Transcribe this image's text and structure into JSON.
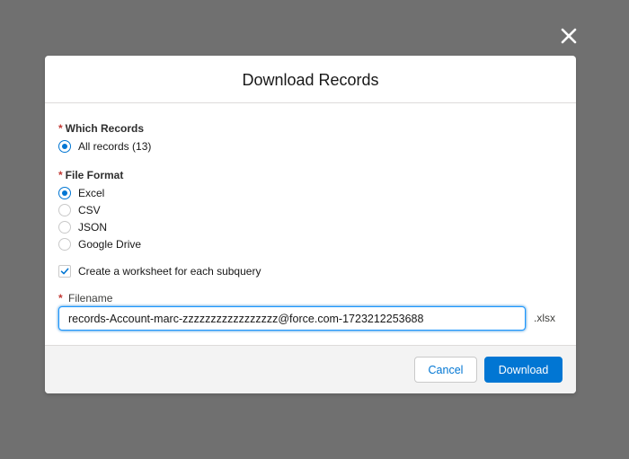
{
  "modal": {
    "title": "Download Records",
    "close_icon": "close-icon"
  },
  "which_records": {
    "label": "Which Records",
    "required_mark": "*",
    "options": [
      {
        "label": "All records (13)",
        "selected": true
      }
    ]
  },
  "file_format": {
    "label": "File Format",
    "required_mark": "*",
    "options": [
      {
        "label": "Excel",
        "selected": true
      },
      {
        "label": "CSV",
        "selected": false
      },
      {
        "label": "JSON",
        "selected": false
      },
      {
        "label": "Google Drive",
        "selected": false
      }
    ]
  },
  "worksheet_option": {
    "label": "Create a worksheet for each subquery",
    "checked": true
  },
  "filename": {
    "label": "Filename",
    "required_mark": "*",
    "value": "records-Account-marc-zzzzzzzzzzzzzzzzz@force.com-1723212253688",
    "extension": ".xlsx"
  },
  "footer": {
    "cancel_label": "Cancel",
    "download_label": "Download"
  },
  "colors": {
    "overlay": "#707070",
    "brand": "#0176d3",
    "required": "#c23934"
  }
}
